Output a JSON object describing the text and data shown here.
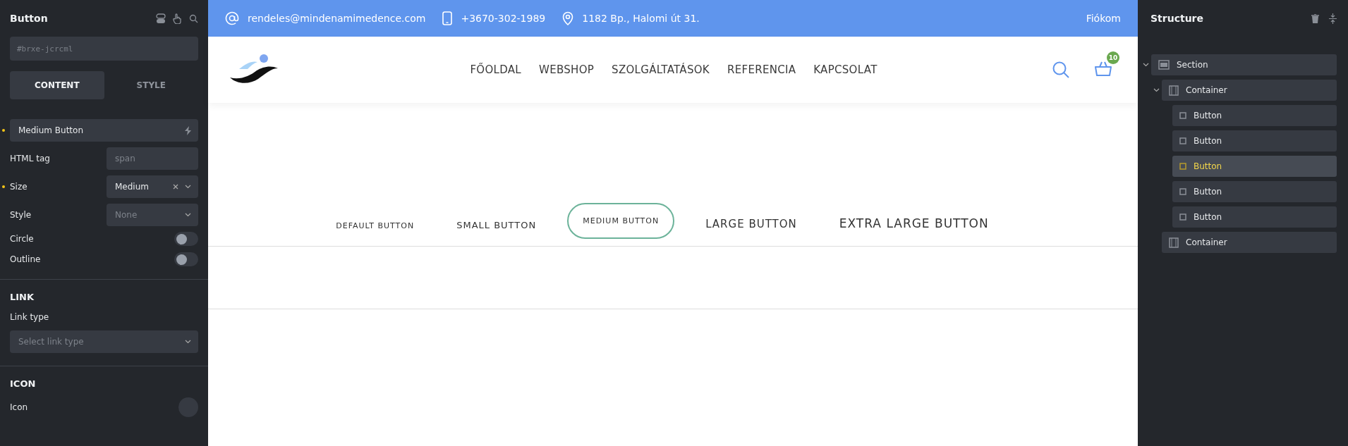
{
  "left_panel": {
    "title": "Button",
    "id_field": {
      "placeholder": "#brxe-jcrcml"
    },
    "tabs": [
      {
        "label": "CONTENT",
        "selected": true
      },
      {
        "label": "STYLE",
        "selected": false
      }
    ],
    "text_field": {
      "value": "Medium Button",
      "modified": true
    },
    "controls": [
      {
        "kind": "input",
        "label": "HTML tag",
        "placeholder": "span",
        "modified": false
      },
      {
        "kind": "select",
        "label": "Size",
        "value": "Medium",
        "modified": true,
        "clearable": true
      },
      {
        "kind": "select",
        "label": "Style",
        "placeholder": "None",
        "modified": false,
        "clearable": false
      },
      {
        "kind": "toggle",
        "label": "Circle",
        "on": false
      },
      {
        "kind": "toggle",
        "label": "Outline",
        "on": false
      }
    ],
    "sections": [
      {
        "title": "LINK",
        "label": "Link type",
        "kind": "select",
        "placeholder": "Select link type"
      },
      {
        "title": "ICON",
        "label": "Icon",
        "kind": "icon"
      }
    ]
  },
  "site": {
    "topbar": {
      "email": "rendeles@mindenamimedence.com",
      "phone": "+3670-302-1989",
      "address": "1182 Bp., Halomi út 31.",
      "account": "Fiókom"
    },
    "nav": [
      "FŐOLDAL",
      "WEBSHOP",
      "SZOLGÁLTATÁSOK",
      "REFERENCIA",
      "KAPCSOLAT"
    ],
    "cart_count": "10",
    "buttons": [
      {
        "label": "DEFAULT BUTTON",
        "kind": "default",
        "selected": false
      },
      {
        "label": "SMALL BUTTON",
        "kind": "small",
        "selected": false
      },
      {
        "label": "MEDIUM BUTTON",
        "kind": "medium",
        "selected": true
      },
      {
        "label": "LARGE BUTTON",
        "kind": "large",
        "selected": false
      },
      {
        "label": "EXTRA LARGE BUTTON",
        "kind": "xl",
        "selected": false
      }
    ]
  },
  "structure": {
    "title": "Structure",
    "tree": [
      {
        "label": "Section",
        "kind": "section",
        "expanded": true,
        "selected": false,
        "children": [
          {
            "label": "Container",
            "kind": "container",
            "expanded": true,
            "selected": false,
            "children": [
              {
                "label": "Button",
                "kind": "button",
                "selected": false
              },
              {
                "label": "Button",
                "kind": "button",
                "selected": false
              },
              {
                "label": "Button",
                "kind": "button",
                "selected": true
              },
              {
                "label": "Button",
                "kind": "button",
                "selected": false
              },
              {
                "label": "Button",
                "kind": "button",
                "selected": false
              }
            ]
          },
          {
            "label": "Container",
            "kind": "container",
            "selected": false
          }
        ]
      }
    ]
  }
}
